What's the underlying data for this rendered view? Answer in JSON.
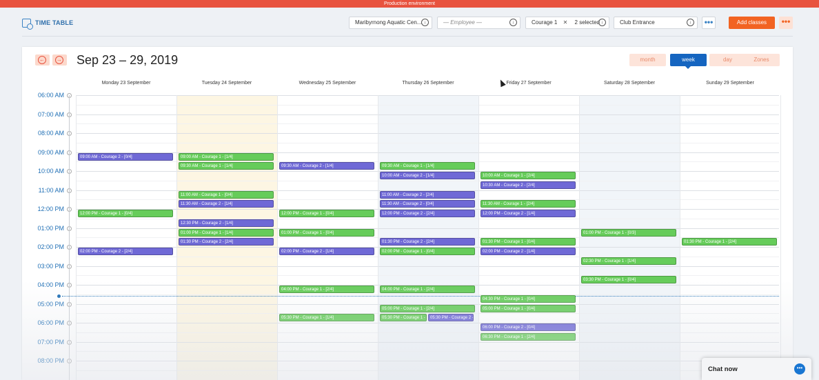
{
  "banner": {
    "text": "Production environment"
  },
  "header": {
    "title": "TIME TABLE",
    "location": "Maribyrnong Aquatic Cen...",
    "employee_placeholder": "— Employee —",
    "course_chip": "Courage 1",
    "selected": "2 selected",
    "area": "Club Entrance",
    "add_label": "Add classes",
    "more": "•••"
  },
  "calendar": {
    "range": "Sep 23 – 29, 2019",
    "views": [
      "month",
      "week",
      "day",
      "Zones"
    ],
    "active_view": "week",
    "days": [
      "Monday 23 September",
      "Tuesday 24 September",
      "Wednesday 25 September",
      "Thursday 26 September",
      "Friday 27 September",
      "Saturday 28 September",
      "Sunday 29 September"
    ],
    "hours": [
      "06:00 AM",
      "07:00 AM",
      "08:00 AM",
      "09:00 AM",
      "10:00 AM",
      "11:00 AM",
      "12:00 PM",
      "01:00 PM",
      "02:00 PM",
      "03:00 PM",
      "04:00 PM",
      "05:00 PM",
      "06:00 PM",
      "07:00 PM",
      "08:00 PM"
    ],
    "colors": {
      "green": "#66cc5a",
      "purple": "#6f69d6",
      "today": "#fdf6e3",
      "shaded": "#f1f5f9"
    },
    "events": [
      {
        "day": 0,
        "start": "09:00",
        "label": "09:00 AM - Courage 2 - [0/4]",
        "color": "purple"
      },
      {
        "day": 0,
        "start": "12:00",
        "label": "12:00 PM - Courage 1 - [0/4]",
        "color": "green"
      },
      {
        "day": 0,
        "start": "14:00",
        "label": "02:00 PM - Courage 2 - [2/4]",
        "color": "purple"
      },
      {
        "day": 1,
        "start": "09:00",
        "label": "09:00 AM - Courage 1 - [1/4]",
        "color": "green"
      },
      {
        "day": 1,
        "start": "09:30",
        "label": "09:30 AM - Courage 1 - [1/4]",
        "color": "green"
      },
      {
        "day": 1,
        "start": "11:00",
        "label": "11:00 AM - Courage 1 - [0/4]",
        "color": "green"
      },
      {
        "day": 1,
        "start": "11:30",
        "label": "11:30 AM - Courage 2 - [1/4]",
        "color": "purple"
      },
      {
        "day": 1,
        "start": "12:30",
        "label": "12:30 PM - Courage 2 - [1/4]",
        "color": "purple"
      },
      {
        "day": 1,
        "start": "13:00",
        "label": "01:00 PM - Courage 1 - [1/4]",
        "color": "green"
      },
      {
        "day": 1,
        "start": "13:30",
        "label": "01:30 PM - Courage 2 - [2/4]",
        "color": "purple"
      },
      {
        "day": 2,
        "start": "09:30",
        "label": "09:30 AM - Courage 2 - [1/4]",
        "color": "purple"
      },
      {
        "day": 2,
        "start": "12:00",
        "label": "12:00 PM - Courage 1 - [0/4]",
        "color": "green"
      },
      {
        "day": 2,
        "start": "13:00",
        "label": "01:00 PM - Courage 1 - [0/4]",
        "color": "green"
      },
      {
        "day": 2,
        "start": "14:00",
        "label": "02:00 PM - Courage 2 - [1/4]",
        "color": "purple"
      },
      {
        "day": 2,
        "start": "16:00",
        "label": "04:00 PM - Courage 1 - [2/4]",
        "color": "green"
      },
      {
        "day": 2,
        "start": "17:30",
        "label": "05:30 PM - Courage 1 - [1/4]",
        "color": "green"
      },
      {
        "day": 3,
        "start": "09:30",
        "label": "09:30 AM - Courage 1 - [1/4]",
        "color": "green"
      },
      {
        "day": 3,
        "start": "10:00",
        "label": "10:00 AM - Courage 2 - [1/4]",
        "color": "purple"
      },
      {
        "day": 3,
        "start": "11:00",
        "label": "11:00 AM - Courage 2 - [2/4]",
        "color": "purple"
      },
      {
        "day": 3,
        "start": "11:30",
        "label": "11:30 AM - Courage 2 - [0/4]",
        "color": "purple"
      },
      {
        "day": 3,
        "start": "12:00",
        "label": "12:00 PM - Courage 2 - [2/4]",
        "color": "purple"
      },
      {
        "day": 3,
        "start": "13:30",
        "label": "01:30 PM - Courage 2 - [2/4]",
        "color": "purple"
      },
      {
        "day": 3,
        "start": "14:00",
        "label": "02:00 PM - Courage 1 - [0/4]",
        "color": "green"
      },
      {
        "day": 3,
        "start": "16:00",
        "label": "04:00 PM - Courage 1 - [2/4]",
        "color": "green"
      },
      {
        "day": 3,
        "start": "17:00",
        "label": "05:00 PM - Courage 1 - [2/4]",
        "color": "green"
      },
      {
        "day": 3,
        "start": "17:30",
        "label": "05:30 PM - Courage 1 - ",
        "color": "green",
        "half": "left"
      },
      {
        "day": 3,
        "start": "17:30",
        "label": "05:30 PM - Courage 2 - ",
        "color": "purple",
        "half": "right"
      },
      {
        "day": 4,
        "start": "10:00",
        "label": "10:00 AM - Courage 1 - [2/4]",
        "color": "green"
      },
      {
        "day": 4,
        "start": "10:30",
        "label": "10:30 AM - Courage 2 - [2/4]",
        "color": "purple"
      },
      {
        "day": 4,
        "start": "11:30",
        "label": "11:30 AM - Courage 1 - [2/4]",
        "color": "green"
      },
      {
        "day": 4,
        "start": "12:00",
        "label": "12:00 PM - Courage 2 - [1/4]",
        "color": "purple"
      },
      {
        "day": 4,
        "start": "13:30",
        "label": "01:30 PM - Courage 1 - [0/4]",
        "color": "green"
      },
      {
        "day": 4,
        "start": "14:00",
        "label": "02:00 PM - Courage 2 - [1/4]",
        "color": "purple"
      },
      {
        "day": 4,
        "start": "16:30",
        "label": "04:30 PM - Courage 1 - [0/4]",
        "color": "green"
      },
      {
        "day": 4,
        "start": "17:00",
        "label": "05:00 PM - Courage 1 - [0/4]",
        "color": "green"
      },
      {
        "day": 4,
        "start": "18:00",
        "label": "06:00 PM - Courage 2 - [0/4]",
        "color": "purple"
      },
      {
        "day": 4,
        "start": "18:30",
        "label": "06:30 PM - Courage 1 - [2/4]",
        "color": "green"
      },
      {
        "day": 5,
        "start": "13:00",
        "label": "01:00 PM - Courage 1 - [0/3]",
        "color": "green"
      },
      {
        "day": 5,
        "start": "14:30",
        "label": "02:30 PM - Courage 1 - [1/4]",
        "color": "green"
      },
      {
        "day": 5,
        "start": "15:30",
        "label": "03:30 PM - Courage 1 - [0/4]",
        "color": "green"
      },
      {
        "day": 6,
        "start": "13:30",
        "label": "01:30 PM - Courage 1 - [2/4]",
        "color": "green"
      }
    ]
  },
  "chat": {
    "label": "Chat now"
  }
}
